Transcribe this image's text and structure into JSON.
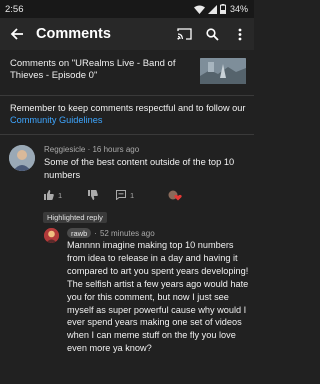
{
  "status_bar": {
    "time": "2:56",
    "battery": "34%"
  },
  "app_bar": {
    "title": "Comments",
    "icons": [
      "back-arrow-icon",
      "cast-icon",
      "search-icon",
      "more-vert-icon"
    ]
  },
  "video": {
    "text": "Comments on \"URealms Live - Band of Thieves - Episode 0\""
  },
  "guidelines": {
    "text": "Remember to keep comments respectful and to follow our",
    "link": "Community Guidelines"
  },
  "comment": {
    "author": "Reggiesicle",
    "time": "16 hours ago",
    "text": "Some of the best content outside of the top 10 numbers",
    "likes": "1",
    "replies": "1"
  },
  "highlighted_label": "Highlighted reply",
  "reply": {
    "author": "rawb",
    "time": "52 minutes ago",
    "text": "Mannnn imagine making top 10 numbers from idea to release in a day and having it compared to art you spent years developing! The selfish artist a few years ago would hate you for this comment, but now I just see myself as super powerful cause why would I ever spend years making one set of videos when I can meme stuff on the fly you love even more ya know?"
  },
  "colors": {
    "background": "#212121",
    "link": "#3ea6ff",
    "heart": "#e53935"
  }
}
